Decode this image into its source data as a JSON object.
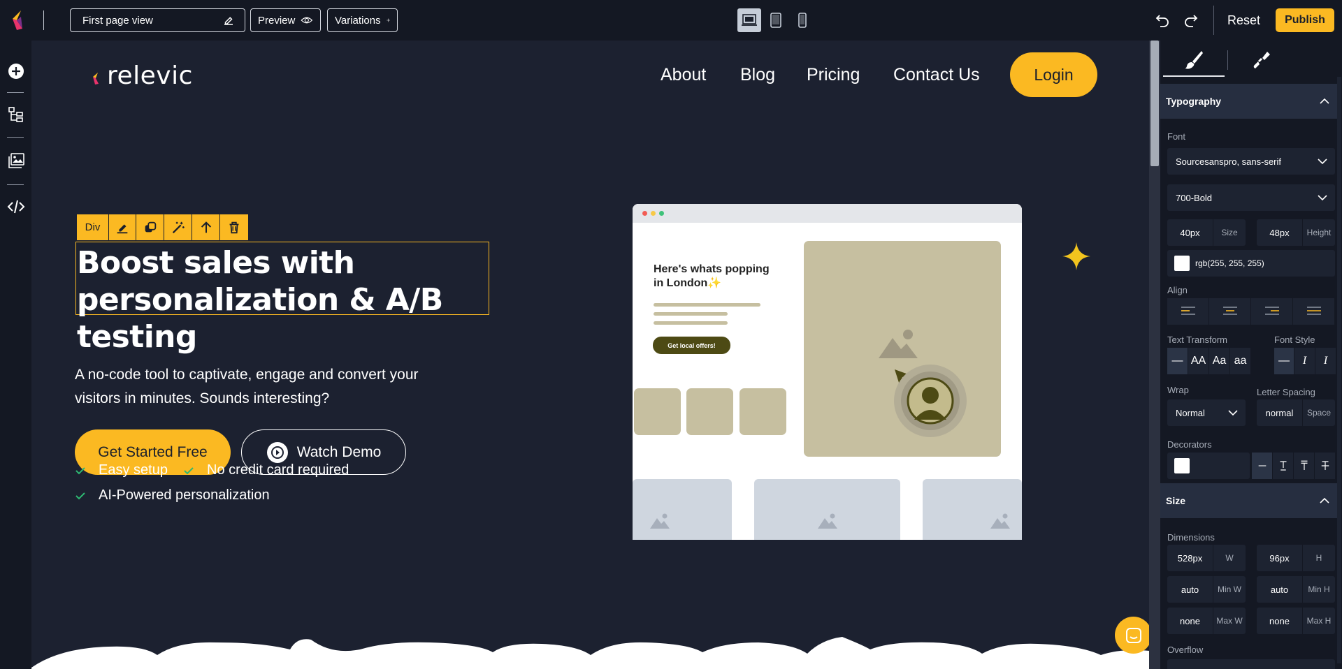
{
  "topbar": {
    "page_name": "First page view",
    "preview_label": "Preview",
    "variations_label": "Variations",
    "reset_label": "Reset",
    "publish_label": "Publish"
  },
  "site": {
    "logo_text": "relevic",
    "nav": [
      "About",
      "Blog",
      "Pricing",
      "Contact Us"
    ],
    "login_label": "Login",
    "hero_title_line1": "Boost sales with",
    "hero_title_line2": "personalization & A/B testing",
    "hero_sub_line1": "A no-code tool to captivate, engage and convert your",
    "hero_sub_line2": "visitors in minutes. Sounds interesting?",
    "cta_primary": "Get Started Free",
    "cta_secondary": "Watch Demo",
    "features": [
      "Easy setup",
      "No credit card required",
      "AI-Powered personalization"
    ],
    "mockup": {
      "heading_line1": "Here's whats popping",
      "heading_line2": "in London",
      "heading_emoji": "✨",
      "button_label": "Get local offers!"
    }
  },
  "selection_toolbar": {
    "tag_label": "Div",
    "icons": [
      "edit-icon",
      "duplicate-icon",
      "magic-wand-icon",
      "arrow-up-icon",
      "trash-icon"
    ]
  },
  "panel": {
    "typography_header": "Typography",
    "font_label": "Font",
    "font_value": "Sourcesanspro, sans-serif",
    "weight_value": "700-Bold",
    "size_value": "40px",
    "size_unit": "Size",
    "height_value": "48px",
    "height_unit": "Height",
    "color_value": "rgb(255, 255, 255)",
    "align_label": "Align",
    "text_transform_label": "Text Transform",
    "transform_options": [
      "—",
      "AA",
      "Aa",
      "aa"
    ],
    "font_style_label": "Font Style",
    "font_style_options": [
      "—",
      "I",
      "I"
    ],
    "wrap_label": "Wrap",
    "wrap_value": "Normal",
    "letter_spacing_label": "Letter Spacing",
    "letter_spacing_value": "normal",
    "letter_spacing_unit": "Space",
    "decorators_label": "Decorators",
    "size_header": "Size",
    "dimensions_label": "Dimensions",
    "width_value": "528px",
    "width_unit": "W",
    "height2_value": "96px",
    "height2_unit": "H",
    "min_w_value": "auto",
    "min_w_unit": "Min W",
    "min_h_value": "auto",
    "min_h_unit": "Min H",
    "max_w_value": "none",
    "max_w_unit": "Max W",
    "max_h_value": "none",
    "max_h_unit": "Max H",
    "overflow_label": "Overflow"
  },
  "colors": {
    "accent": "#fbb922",
    "bg": "#1c2130",
    "panel": "#141823",
    "check": "#2eb872"
  }
}
